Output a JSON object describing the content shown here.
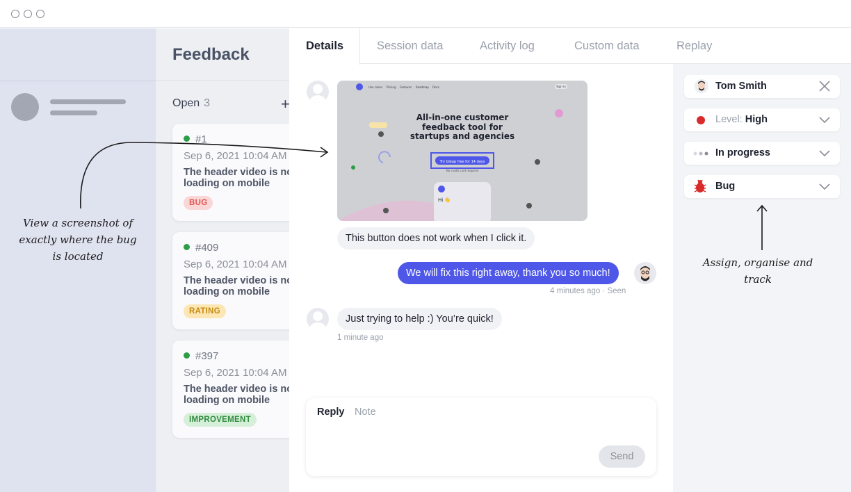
{
  "sidebar": {
    "annotation_left": [
      "View a screenshot of",
      "exactly where the bug",
      "is located"
    ]
  },
  "feedback": {
    "title": "Feedback",
    "open_label": "Open",
    "open_count": "3",
    "add_icon": "plus-icon",
    "cards": [
      {
        "id": "#1",
        "date": "Sep 6, 2021 10:04 AM",
        "line1": "The header video is not",
        "line2": "loading on mobile",
        "tag": "BUG",
        "tag_color": "#e05656",
        "tag_bg": "#f9d7d7"
      },
      {
        "id": "#409",
        "date": "Sep 6, 2021 10:04 AM",
        "line1": "The header video is not",
        "line2": "loading on mobile",
        "tag": "RATING",
        "tag_color": "#c78a0f",
        "tag_bg": "#fbe6b4"
      },
      {
        "id": "#397",
        "date": "Sep 6, 2021 10:04 AM",
        "line1": "The header video is not",
        "line2": "loading on mobile",
        "tag": "IMPROVEMENT",
        "tag_color": "#2f8a3e",
        "tag_bg": "#d6efd9"
      }
    ]
  },
  "tabs": [
    "Details",
    "Session data",
    "Activity log",
    "Custom data",
    "Replay"
  ],
  "screenshot": {
    "nav": [
      "Use cases",
      "Pricing",
      "Features",
      "Roadmap",
      "Docs"
    ],
    "signin": "Sign in",
    "headline": [
      "All-in-one customer",
      "feedback tool for",
      "startups and agencies"
    ],
    "cta": "Try Gleap free for 14 days",
    "nocard": "No credit card required",
    "widget_hi": "Hi 👋"
  },
  "chat": {
    "msg1": "This button does not work when I click it.",
    "msg2": "We will fix this right away, thank you so much!",
    "msg2_meta": "4 minutes ago · Seen",
    "msg3": "Just trying to help :) You’re quick!",
    "msg3_meta": "1 minute ago"
  },
  "reply": {
    "tab_reply": "Reply",
    "tab_note": "Note",
    "send": "Send"
  },
  "properties": {
    "assignee": "Tom Smith",
    "level_prefix": "Level:",
    "level_value": "High",
    "status": "In progress",
    "type": "Bug",
    "colors": {
      "level": "#d92b2b",
      "bug": "#d92b2b",
      "brand": "#4e57e8"
    }
  },
  "annotation_right": [
    "Assign, organise and",
    "track"
  ]
}
